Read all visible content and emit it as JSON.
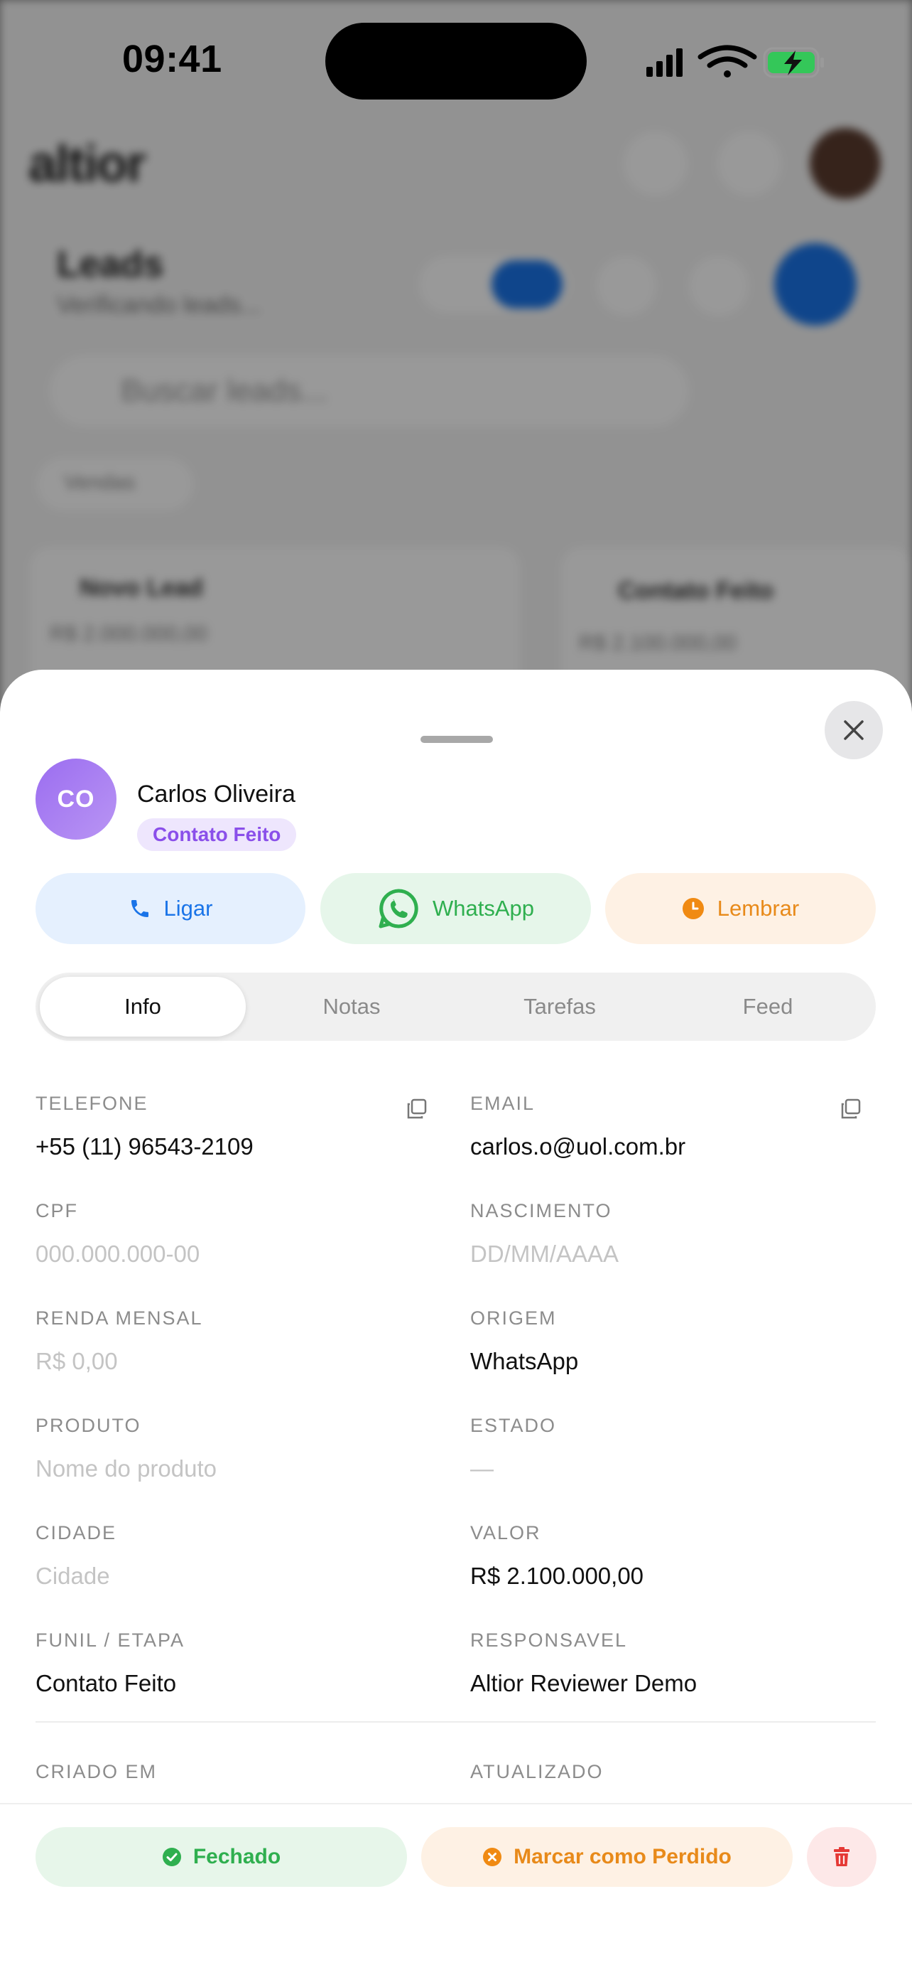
{
  "status_bar": {
    "time": "09:41"
  },
  "background": {
    "logo": "altior",
    "title": "Leads",
    "subtitle": "Verificando leads...",
    "search_placeholder": "Buscar leads...",
    "filter_label": "Vendas",
    "column_1": {
      "title": "Novo Lead",
      "subtitle": "R$ 2.000.000,00"
    },
    "column_2": {
      "title": "Contato Feito",
      "subtitle": "R$ 2.100.000,00"
    }
  },
  "lead": {
    "initials": "CO",
    "name": "Carlos Oliveira",
    "stage": "Contato Feito"
  },
  "actions": {
    "call": "Ligar",
    "whatsapp": "WhatsApp",
    "remind": "Lembrar"
  },
  "tabs": [
    "Info",
    "Notas",
    "Tarefas",
    "Feed"
  ],
  "active_tab": "Info",
  "fields": {
    "telefone": {
      "label": "TELEFONE",
      "value": "+55 (11) 96543-2109"
    },
    "email": {
      "label": "EMAIL",
      "value": "carlos.o@uol.com.br"
    },
    "cpf": {
      "label": "CPF",
      "placeholder": "000.000.000-00"
    },
    "nascimento": {
      "label": "NASCIMENTO",
      "placeholder": "DD/MM/AAAA"
    },
    "renda": {
      "label": "RENDA MENSAL",
      "placeholder": "R$ 0,00"
    },
    "origem": {
      "label": "ORIGEM",
      "value": "WhatsApp"
    },
    "produto": {
      "label": "PRODUTO",
      "placeholder": "Nome do produto"
    },
    "estado": {
      "label": "ESTADO",
      "placeholder": "—"
    },
    "cidade": {
      "label": "CIDADE",
      "placeholder": "Cidade"
    },
    "valor": {
      "label": "VALOR",
      "value": "R$ 2.100.000,00"
    },
    "funil": {
      "label": "FUNIL / ETAPA",
      "value": "Contato Feito"
    },
    "responsavel": {
      "label": "RESPONSAVEL",
      "value": "Altior Reviewer Demo"
    },
    "criado": {
      "label": "CRIADO EM"
    },
    "atualizado": {
      "label": "ATUALIZADO"
    }
  },
  "footer": {
    "closed": "Fechado",
    "lost": "Marcar como Perdido"
  },
  "colors": {
    "accent_blue": "#1a74e8",
    "whatsapp_green": "#2faf4f",
    "remind_orange": "#e88a1a",
    "stage_purple": "#8a4fea",
    "delete_red": "#e53935"
  }
}
